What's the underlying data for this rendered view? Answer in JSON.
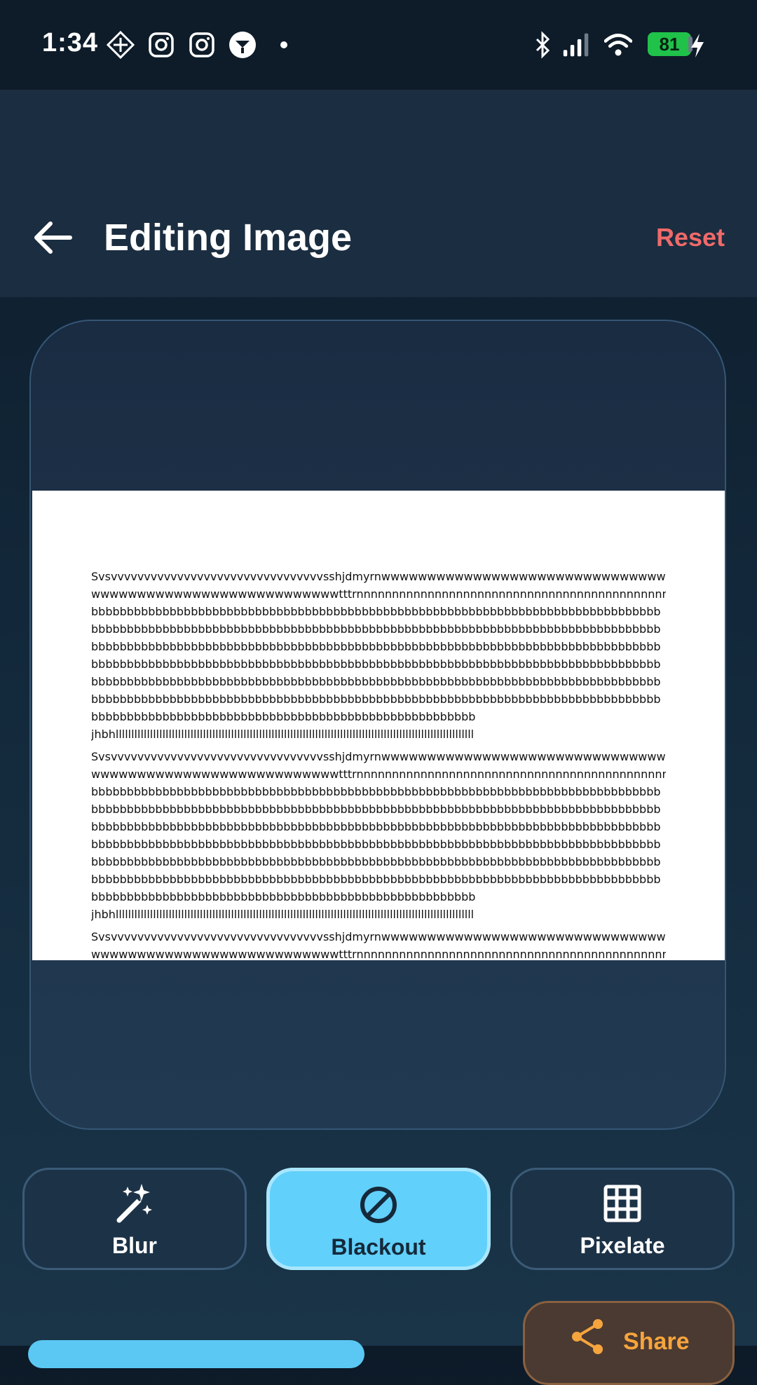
{
  "status_bar": {
    "time": "1:34",
    "icons": [
      "nav-diamond-icon",
      "instagram-icon",
      "instagram-icon",
      "mail-circle-icon",
      "dot-icon",
      "bluetooth-icon",
      "signal-icon",
      "wifi-icon",
      "battery-icon",
      "charging-icon"
    ],
    "battery_level": "81",
    "battery_color": "#20c24a"
  },
  "header": {
    "back_icon": "arrow-left-icon",
    "title": "Editing Image",
    "reset_label": "Reset",
    "reset_color": "#f06a6a"
  },
  "document": {
    "paragraphs": [
      {
        "lines": [
          "Svsvvvvvvvvvvvvvvvvvvvvvvvvvvvvvvvvsshjdmyrnwwwwwwwwwwwwwwwwwwwwwwwwwwwwwwwwwwwwww",
          "wwwwwwwwwwwwwwwwwwwwwwwwwwwtttrnnnnnnnnnnnnnnnnnnnnnnnnnnnnnnnnnnnnnnnnnnnnnaebbbbbbbb",
          "bbbbbbbbbbbbbbbbbbbbbbbbbbbbbbbbbbbbbbbbbbbbbbbbbbbbbbbbbbbbbbbbbbbbbbbbbbbbbbbb",
          "bbbbbbbbbbbbbbbbbbbbbbbbbbbbbbbbbbbbbbbbbbbbbbbbbbbbbbbbbbbbbbbbbbbbbbbbbbbbbbbb",
          "bbbbbbbbbbbbbbbbbbbbbbbbbbbbbbbbbbbbbbbbbbbbbbbbbbbbbbbbbbbbbbbbbbbbbbbbbbbbbbbb",
          "bbbbbbbbbbbbbbbbbbbbbbbbbbbbbbbbbbbbbbbbbbbbbbbbbbbbbbbbbbbbbbbbbbbbbbbbbbbbbbbb",
          "bbbbbbbbbbbbbbbbbbbbbbbbbbbbbbbbbbbbbbbbbbbbbbbbbbbbbbbbbbbbbbbbbbbbbbbbbbbbbbbb",
          "bbbbbbbbbbbbbbbbbbbbbbbbbbbbbbbbbbbbbbbbbbbbbbbbbbbbbbbbbbbbbbbbbbbbbbbbbbbbbbbb",
          "bbbbbbbbbbbbbbbbbbbbbbbbbbbbbbbbbbbbbbbbbbbbbbbbbbbbbb",
          "jhbhlllllllllllllllllllllllllllllllllllllllllllllllllllllllllllllllllllllllllllllllllllllllllllllllllllllllllllllllllll"
        ]
      },
      {
        "lines": [
          "Svsvvvvvvvvvvvvvvvvvvvvvvvvvvvvvvvvsshjdmyrnwwwwwwwwwwwwwwwwwwwwwwwwwwwwwwwwwwwwww",
          "wwwwwwwwwwwwwwwwwwwwwwwwwwwtttrnnnnnnnnnnnnnnnnnnnnnnnnnnnnnnnnnnnnnnnnnnnnnaebbbbbbbb",
          "bbbbbbbbbbbbbbbbbbbbbbbbbbbbbbbbbbbbbbbbbbbbbbbbbbbbbbbbbbbbbbbbbbbbbbbbbbbbbbbb",
          "bbbbbbbbbbbbbbbbbbbbbbbbbbbbbbbbbbbbbbbbbbbbbbbbbbbbbbbbbbbbbbbbbbbbbbbbbbbbbbbb",
          "bbbbbbbbbbbbbbbbbbbbbbbbbbbbbbbbbbbbbbbbbbbbbbbbbbbbbbbbbbbbbbbbbbbbbbbbbbbbbbbb",
          "bbbbbbbbbbbbbbbbbbbbbbbbbbbbbbbbbbbbbbbbbbbbbbbbbbbbbbbbbbbbbbbbbbbbbbbbbbbbbbbb",
          "bbbbbbbbbbbbbbbbbbbbbbbbbbbbbbbbbbbbbbbbbbbbbbbbbbbbbbbbbbbbbbbbbbbbbbbbbbbbbbbb",
          "bbbbbbbbbbbbbbbbbbbbbbbbbbbbbbbbbbbbbbbbbbbbbbbbbbbbbbbbbbbbbbbbbbbbbbbbbbbbbbbb",
          "bbbbbbbbbbbbbbbbbbbbbbbbbbbbbbbbbbbbbbbbbbbbbbbbbbbbbb",
          "jhbhlllllllllllllllllllllllllllllllllllllllllllllllllllllllllllllllllllllllllllllllllllllllllllllllllllllllllllllllllll"
        ]
      },
      {
        "lines": [
          "Svsvvvvvvvvvvvvvvvvvvvvvvvvvvvvvvvvsshjdmyrnwwwwwwwwwwwwwwwwwwwwwwwwwwwwwwwwwwwwww",
          "wwwwwwwwwwwwwwwwwwwwwwwwwwwtttrnnnnnnnnnnnnnnnnnnnnnnnnnnnnnnnnnnnnnnnnnnnnaebbbbbbbb"
        ]
      }
    ]
  },
  "tools": [
    {
      "label": "Blur",
      "icon": "magic-wand-icon",
      "active": false
    },
    {
      "label": "Blackout",
      "icon": "block-icon",
      "active": true
    },
    {
      "label": "Pixelate",
      "icon": "grid-icon",
      "active": false
    }
  ],
  "actions": {
    "share_label": "Share",
    "share_icon": "share-icon",
    "share_color": "#f6a43d"
  }
}
